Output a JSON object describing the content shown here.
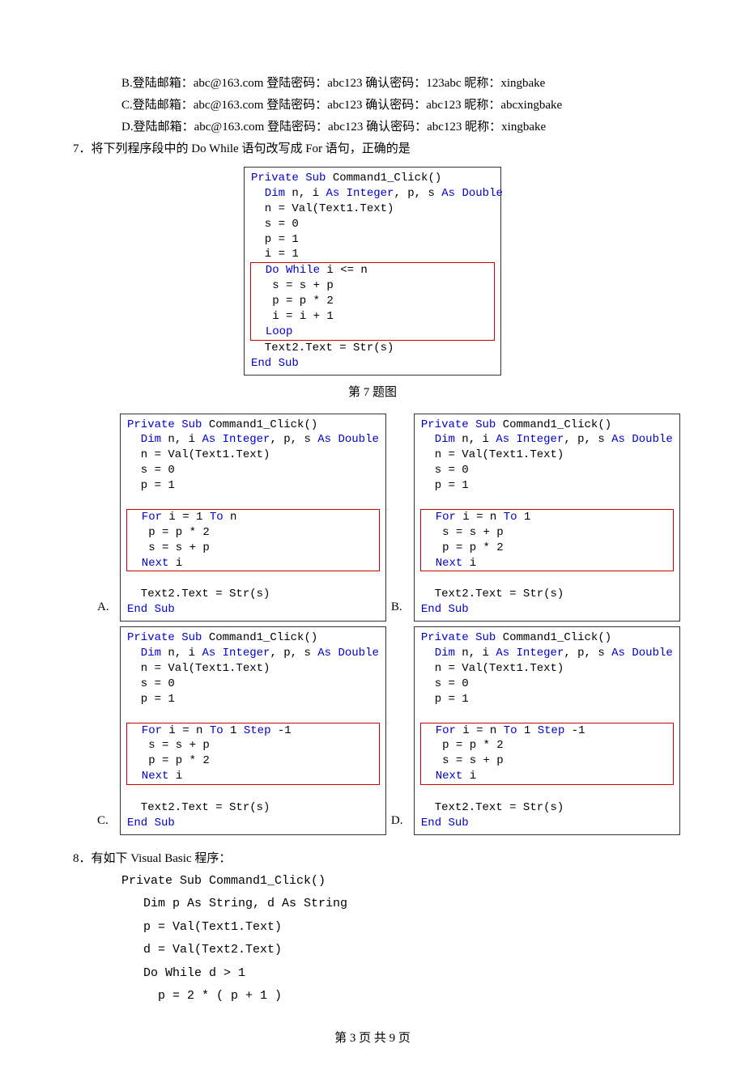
{
  "options_top": {
    "B": "B.登陆邮箱：abc@163.com 登陆密码：abc123 确认密码：123abc 昵称：xingbake",
    "C": "C.登陆邮箱：abc@163.com 登陆密码：abc123 确认密码：abc123 昵称：abcxingbake",
    "D": "D.登陆邮箱：abc@163.com 登陆密码：abc123 确认密码：abc123 昵称：xingbake"
  },
  "q7": {
    "stem": "7．将下列程序段中的 Do While 语句改写成 For 语句，正确的是",
    "caption": "第 7 题图",
    "main_code": {
      "l1a": "Private Sub",
      "l1b": " Command1_Click()",
      "l2a": "  Dim",
      "l2b": " n, i ",
      "l2c": "As Integer",
      "l2d": ", p, s ",
      "l2e": "As Double",
      "l3": "  n = Val(Text1.Text)",
      "l4": "  s = 0",
      "l5": "  p = 1",
      "l6": "  i = 1",
      "r1a": "  Do While",
      "r1b": " i <= n",
      "r2": "   s = s + p",
      "r3": "   p = p * 2",
      "r4": "   i = i + 1",
      "r5": "  Loop",
      "l7": "  Text2.Text = Str(s)",
      "l8": "End Sub"
    },
    "labels": {
      "A": "A.",
      "B": "B.",
      "C": "C.",
      "D": "D."
    },
    "optA": {
      "r1a": "  For",
      "r1b": " i = 1 ",
      "r1c": "To",
      "r1d": " n",
      "r2": "   p = p * 2",
      "r3": "   s = s + p",
      "r4": "  Next",
      "r4b": " i"
    },
    "optB": {
      "r1a": "  For",
      "r1b": " i = n ",
      "r1c": "To",
      "r1d": " 1",
      "r2": "   s = s + p",
      "r3": "   p = p * 2",
      "r4": "  Next",
      "r4b": " i"
    },
    "optC": {
      "r1a": "  For",
      "r1b": " i = n ",
      "r1c": "To",
      "r1d": " 1 ",
      "r1e": "Step",
      "r1f": " -1",
      "r2": "   s = s + p",
      "r3": "   p = p * 2",
      "r4": "  Next",
      "r4b": " i"
    },
    "optD": {
      "r1a": "  For",
      "r1b": " i = n ",
      "r1c": "To",
      "r1d": " 1 ",
      "r1e": "Step",
      "r1f": " -1",
      "r2": "   p = p * 2",
      "r3": "   s = s + p",
      "r4": "  Next",
      "r4b": " i"
    },
    "common": {
      "tail1": "  Text2.Text = Str(s)",
      "tail2": "End Sub"
    }
  },
  "q8": {
    "stem": "8．有如下 Visual Basic 程序：",
    "code": "Private Sub Command1_Click()\n   Dim p As String, d As String\n   p = Val(Text1.Text)\n   d = Val(Text2.Text)\n   Do While d > 1\n     p = 2 * ( p + 1 )"
  },
  "footer": "第 3 页 共 9 页"
}
